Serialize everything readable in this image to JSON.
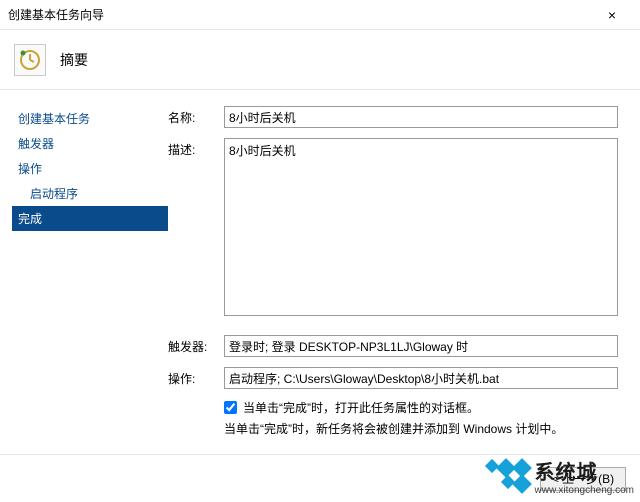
{
  "window": {
    "title": "创建基本任务向导",
    "close": "×"
  },
  "header": {
    "title": "摘要"
  },
  "sidebar": {
    "items": [
      {
        "label": "创建基本任务",
        "sub": false,
        "selected": false
      },
      {
        "label": "触发器",
        "sub": false,
        "selected": false
      },
      {
        "label": "操作",
        "sub": false,
        "selected": false
      },
      {
        "label": "启动程序",
        "sub": true,
        "selected": false
      },
      {
        "label": "完成",
        "sub": false,
        "selected": true
      }
    ]
  },
  "fields": {
    "name_label": "名称:",
    "name_value": "8小时后关机",
    "desc_label": "描述:",
    "desc_value": "8小时后关机",
    "trigger_label": "触发器:",
    "trigger_value": "登录时; 登录 DESKTOP-NP3L1LJ\\Gloway 时",
    "action_label": "操作:",
    "action_value": "启动程序; C:\\Users\\Gloway\\Desktop\\8小时关机.bat"
  },
  "checkbox": {
    "checked": true,
    "label": "当单击“完成”时，打开此任务属性的对话框。"
  },
  "note": "当单击“完成”时，新任务将会被创建并添加到 Windows 计划中。",
  "footer": {
    "back": "< 上一步(B)"
  },
  "watermark": {
    "big": "系统城",
    "small": "www.xitongcheng.com"
  }
}
